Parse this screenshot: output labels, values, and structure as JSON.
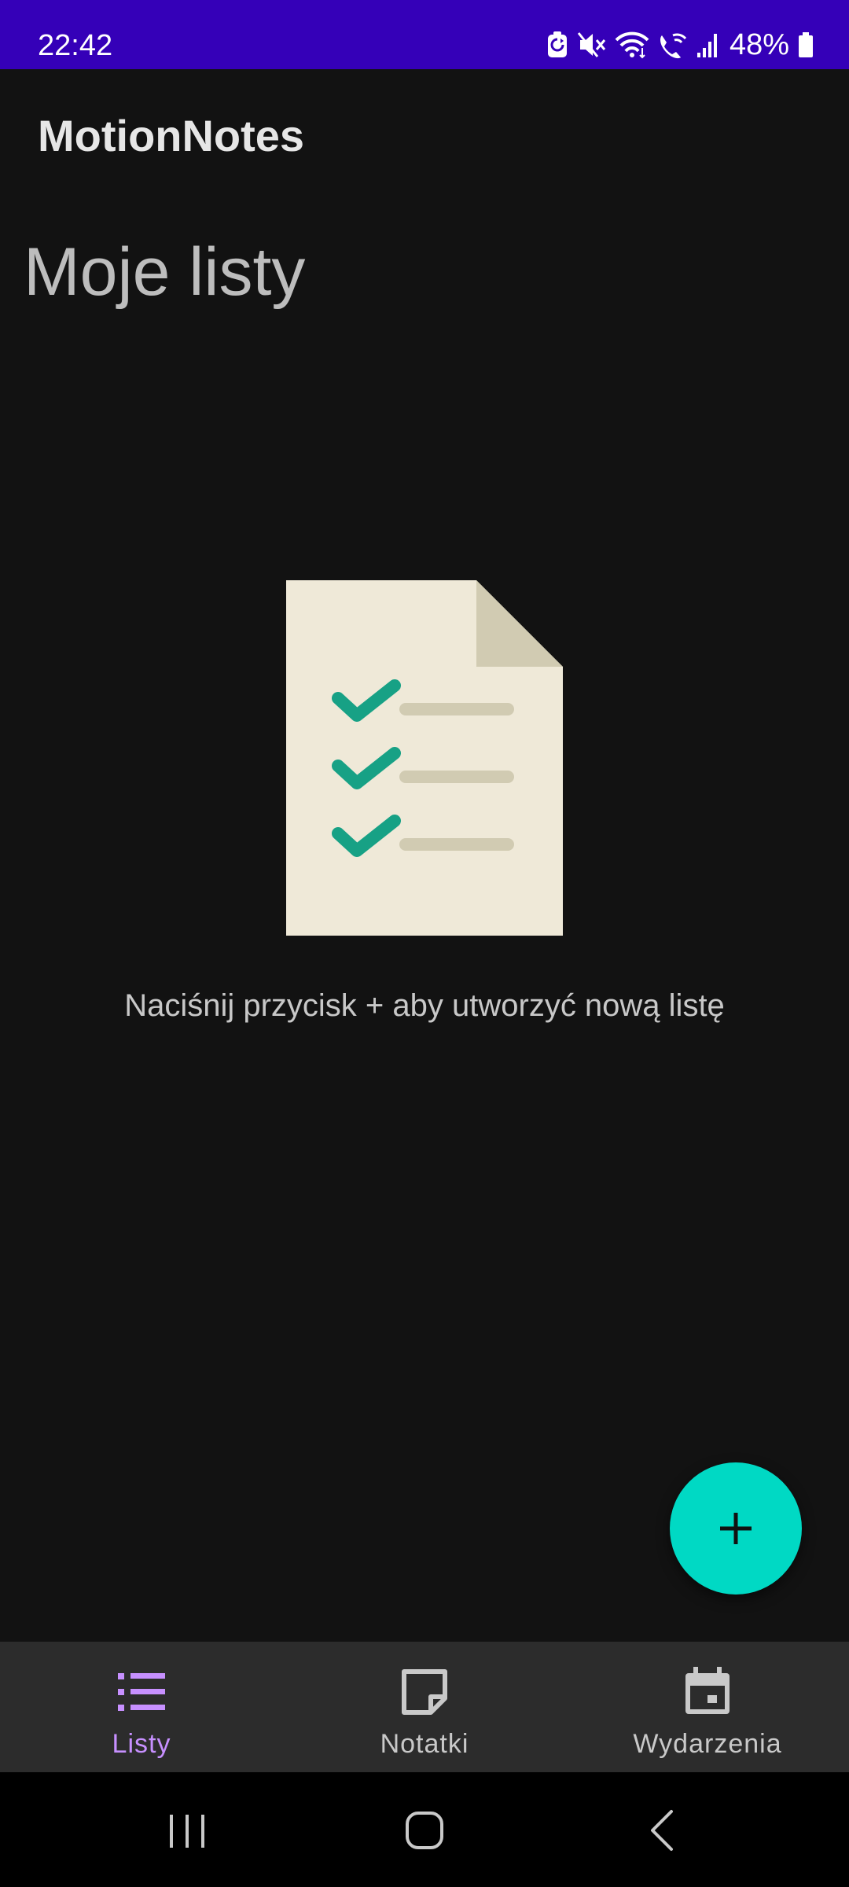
{
  "status_bar": {
    "time": "22:42",
    "battery_percent": "48%",
    "icons": [
      "battery-saver-icon",
      "mute-icon",
      "wifi-icon",
      "wifi-calling-icon",
      "signal-icon",
      "battery-icon"
    ]
  },
  "app_bar": {
    "title": "MotionNotes"
  },
  "page": {
    "heading": "Moje listy",
    "empty_message": "Naciśnij przycisk + aby utworzyć nową listę",
    "illustration": "checklist-document-icon"
  },
  "fab": {
    "icon": "plus-icon"
  },
  "bottom_nav": {
    "items": [
      {
        "label": "Listy",
        "icon": "list-icon",
        "active": true
      },
      {
        "label": "Notatki",
        "icon": "note-icon",
        "active": false
      },
      {
        "label": "Wydarzenia",
        "icon": "calendar-icon",
        "active": false
      }
    ]
  },
  "system_nav": {
    "buttons": [
      "recents-icon",
      "home-icon",
      "back-icon"
    ]
  },
  "colors": {
    "status_bar": "#3500b8",
    "background": "#121212",
    "fab": "#00d9c4",
    "nav_background": "#2c2c2c",
    "nav_active": "#c790ff",
    "check": "#17a185",
    "paper": "#efe9d8"
  }
}
